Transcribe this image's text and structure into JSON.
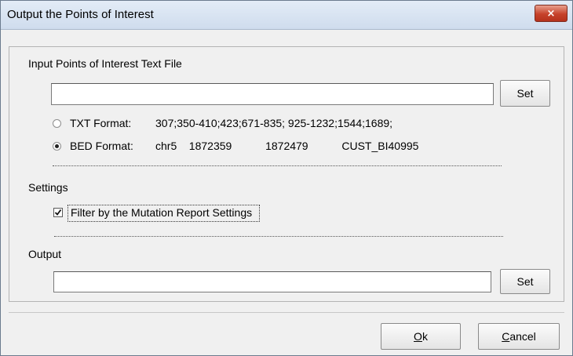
{
  "window": {
    "title": "Output the Points of Interest",
    "close_icon": "×"
  },
  "input_section": {
    "label": "Input Points of Interest Text File",
    "file_value": "",
    "set_label": "Set"
  },
  "formats": [
    {
      "label": "TXT Format:",
      "example": "307;350-410;423;671-835;     925-1232;1544;1689;",
      "selected": false
    },
    {
      "label": "BED Format:",
      "example": "chr5    1872359           1872479           CUST_BI40995",
      "selected": true
    }
  ],
  "settings": {
    "label": "Settings",
    "filter_label": "Filter by the Mutation Report Settings",
    "filter_checked": true
  },
  "output_section": {
    "label": "Output",
    "file_value": "",
    "set_label": "Set"
  },
  "buttons": {
    "ok_mnemonic": "O",
    "ok_rest": "k",
    "cancel_mnemonic": "C",
    "cancel_rest": "ancel"
  }
}
